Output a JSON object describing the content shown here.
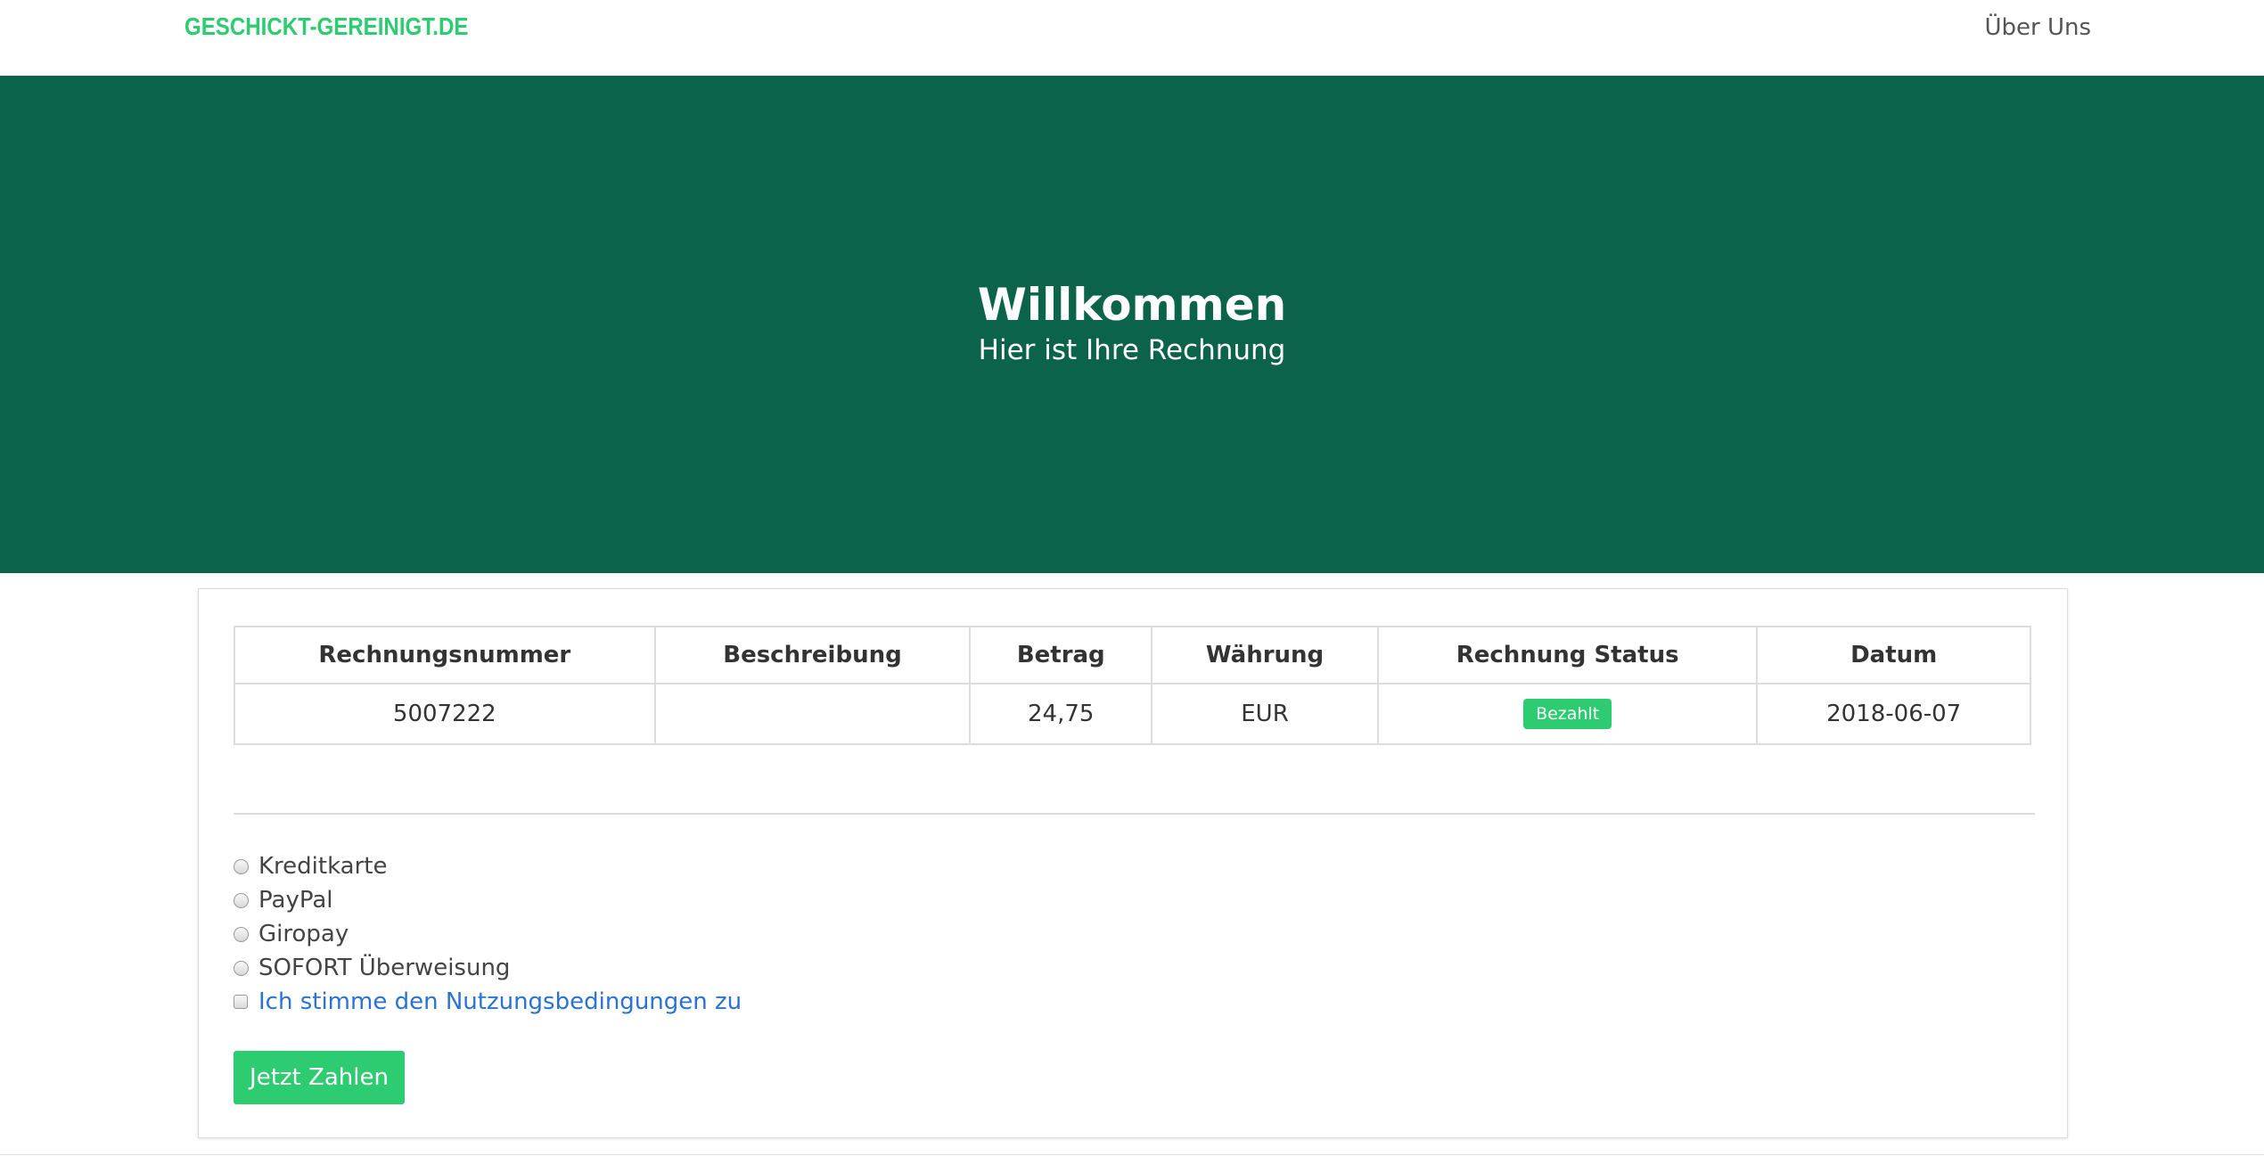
{
  "navbar": {
    "brand": "GESCHICKT-GEREINIGT.DE",
    "about_link": "Über Uns"
  },
  "hero": {
    "title": "Willkommen",
    "subtitle": "Hier ist Ihre Rechnung",
    "background_color": "#0b634a"
  },
  "invoice": {
    "headers": [
      "Rechnungsnummer",
      "Beschreibung",
      "Betrag",
      "Währung",
      "Rechnung Status",
      "Datum"
    ],
    "rows": [
      {
        "number": "5007222",
        "description": "",
        "amount": "24,75",
        "currency": "EUR",
        "status": "Bezahlt",
        "date": "2018-06-07"
      }
    ]
  },
  "payment": {
    "options": [
      "Kreditkarte",
      "PayPal",
      "Giropay",
      "SOFORT Überweisung"
    ],
    "terms_label": "Ich stimme den Nutzungsbedingungen zu",
    "pay_button": "Jetzt Zahlen"
  },
  "colors": {
    "accent": "#2ecc71",
    "link": "#2a72d4"
  }
}
